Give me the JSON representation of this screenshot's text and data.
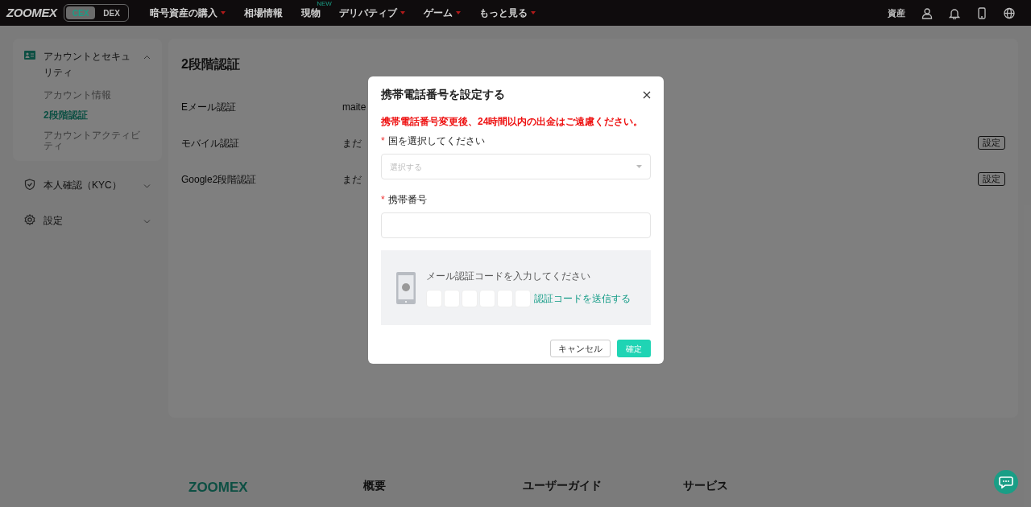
{
  "header": {
    "logo": "ZOOMEX",
    "mode_toggle": [
      {
        "label": "CEX",
        "selected": true
      },
      {
        "label": "DEX",
        "selected": false
      }
    ],
    "nav": [
      {
        "label": "暗号資産の購入",
        "dropdown": true
      },
      {
        "label": "相場情報",
        "dropdown": false
      },
      {
        "label": "現物",
        "dropdown": false,
        "badge": "NEW"
      },
      {
        "label": "デリバティブ",
        "dropdown": true
      },
      {
        "label": "ゲーム",
        "dropdown": true
      },
      {
        "label": "もっと見る",
        "dropdown": true
      }
    ],
    "assets": "資産"
  },
  "sidebar": [
    {
      "label": "アカウントとセキュリティ",
      "expanded": true,
      "children": [
        {
          "label": "アカウント情報",
          "selected": false
        },
        {
          "label": "2段階認証",
          "selected": true
        },
        {
          "label": "アカウントアクティビティ",
          "selected": false
        }
      ]
    },
    {
      "label": "本人確認（KYC）",
      "expanded": false
    },
    {
      "label": "設定",
      "expanded": false
    }
  ],
  "main": {
    "title": "2段階認証",
    "rows": [
      {
        "label": "Eメール認証",
        "value": "maite"
      },
      {
        "label": "モバイル認証",
        "value": "まだ",
        "button": "設定"
      },
      {
        "label": "Google2段階認証",
        "value": "まだ",
        "button": "設定"
      }
    ]
  },
  "modal": {
    "title": "携帯電話番号を設定する",
    "warning": "携帯電話番号変更後、24時間以内の出金はご遠慮ください。",
    "country": {
      "marker": "*",
      "label": "国を選択してください",
      "placeholder": "選択する"
    },
    "phone": {
      "marker": "*",
      "label": "携帯番号"
    },
    "verification": {
      "label": "メール認証コードを入力してください",
      "send": "認証コードを送信する"
    },
    "buttons": [
      {
        "label": "キャンセル",
        "kind": "secondary"
      },
      {
        "label": "確定",
        "kind": "primary"
      }
    ]
  },
  "footer": {
    "logo": "ZOOMEX",
    "headings": [
      "概要",
      "ユーザーガイド",
      "サービス"
    ]
  }
}
